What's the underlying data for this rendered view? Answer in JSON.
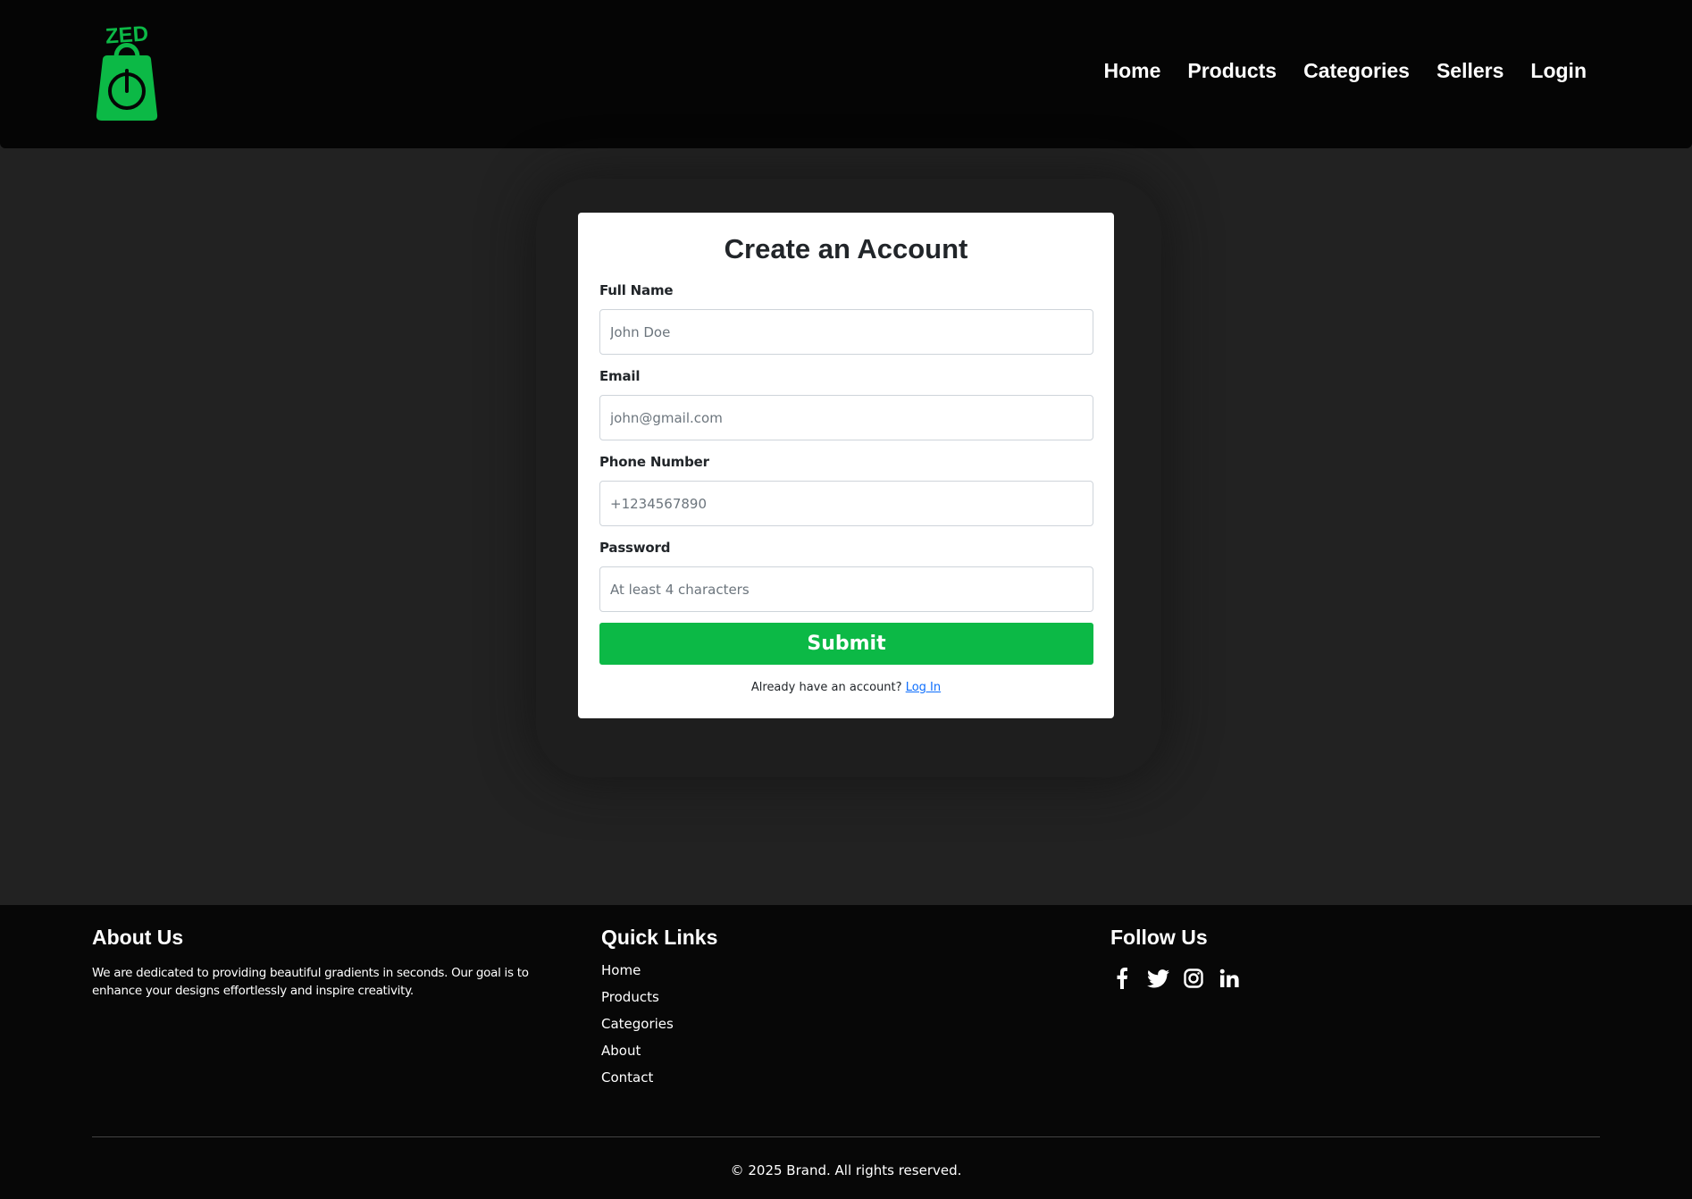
{
  "header": {
    "logo_text": "ZED",
    "nav": [
      "Home",
      "Products",
      "Categories",
      "Sellers",
      "Login"
    ]
  },
  "form": {
    "title": "Create an Account",
    "fields": [
      {
        "label": "Full Name",
        "placeholder": "John Doe",
        "value": ""
      },
      {
        "label": "Email",
        "placeholder": "john@gmail.com",
        "value": ""
      },
      {
        "label": "Phone Number",
        "placeholder": "+1234567890",
        "value": ""
      },
      {
        "label": "Password",
        "placeholder": "At least 4 characters",
        "value": ""
      }
    ],
    "submit_label": "Submit",
    "signin_prompt": "Already have an account?",
    "signin_link": "Log In"
  },
  "footer": {
    "about_title": "About Us",
    "about_text": "We are dedicated to providing beautiful gradients in seconds. Our goal is to enhance your designs effortlessly and inspire creativity.",
    "quick_title": "Quick Links",
    "quick_links": [
      "Home",
      "Products",
      "Categories",
      "About",
      "Contact"
    ],
    "follow_title": "Follow Us",
    "social_icons": [
      "facebook-icon",
      "twitter-icon",
      "instagram-icon",
      "linkedin-icon"
    ],
    "copyright": "© 2025 Brand. All rights reserved."
  },
  "colors": {
    "accent": "#0cb946",
    "header_bg": "#050505",
    "page_bg": "#222222",
    "link": "#0d6efd"
  }
}
